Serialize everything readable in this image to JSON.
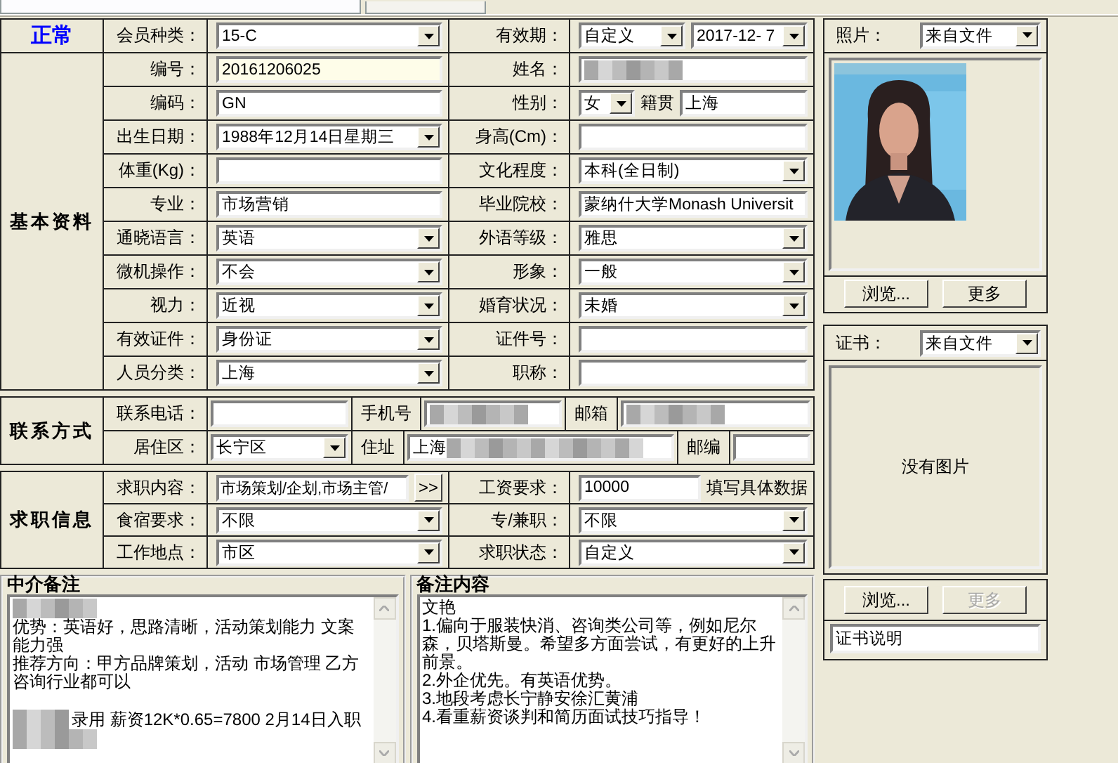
{
  "tabs": [
    {
      "selected": true
    },
    {
      "selected": false
    }
  ],
  "basic": {
    "status": "正常",
    "title": "基本资料",
    "header": {
      "left": {
        "label": "会员种类：",
        "kind": "dropdown",
        "value": "15-C"
      },
      "right": {
        "label": "有效期：",
        "kind": "dropdown-pair",
        "value": "自定义",
        "value2": "2017-12- 7"
      }
    },
    "rows": [
      {
        "left": {
          "label": "编号：",
          "kind": "highlight",
          "value": "20161206025"
        },
        "right": {
          "label": "姓名：",
          "kind": "text",
          "redacted": true
        }
      },
      {
        "left": {
          "label": "编码：",
          "kind": "text",
          "value": "GN"
        },
        "right": {
          "label": "性别：",
          "kind": "gender-origin",
          "value": "女",
          "extra_label": "籍贯",
          "extra_value": "上海"
        }
      },
      {
        "left": {
          "label": "出生日期：",
          "kind": "dropdown",
          "value": "1988年12月14日星期三"
        },
        "right": {
          "label": "身高(Cm)：",
          "kind": "text"
        }
      },
      {
        "left": {
          "label": "体重(Kg)：",
          "kind": "text"
        },
        "right": {
          "label": "文化程度：",
          "kind": "dropdown",
          "value": "本科(全日制)"
        }
      },
      {
        "left": {
          "label": "专业：",
          "kind": "text",
          "value": "市场营销"
        },
        "right": {
          "label": "毕业院校：",
          "kind": "text",
          "value": "蒙纳什大学Monash Universit"
        }
      },
      {
        "left": {
          "label": "通晓语言：",
          "kind": "dropdown",
          "value": "英语"
        },
        "right": {
          "label": "外语等级：",
          "kind": "dropdown",
          "value": "雅思"
        }
      },
      {
        "left": {
          "label": "微机操作：",
          "kind": "dropdown",
          "value": "不会"
        },
        "right": {
          "label": "形象：",
          "kind": "dropdown",
          "value": "一般"
        }
      },
      {
        "left": {
          "label": "视力：",
          "kind": "dropdown",
          "value": "近视"
        },
        "right": {
          "label": "婚育状况：",
          "kind": "dropdown",
          "value": "未婚"
        }
      },
      {
        "left": {
          "label": "有效证件：",
          "kind": "dropdown",
          "value": "身份证"
        },
        "right": {
          "label": "证件号：",
          "kind": "text"
        }
      },
      {
        "left": {
          "label": "人员分类：",
          "kind": "dropdown",
          "value": "上海"
        },
        "right": {
          "label": "职称：",
          "kind": "text"
        }
      }
    ]
  },
  "contact": {
    "title": "联系方式",
    "rows": [
      {
        "label": "联系电话：",
        "fields": [
          {
            "kind": "text"
          },
          {
            "kind": "label",
            "label": "手机号"
          },
          {
            "kind": "text",
            "redacted": true
          },
          {
            "kind": "label",
            "label": "邮箱"
          },
          {
            "kind": "text",
            "redacted": true
          }
        ]
      },
      {
        "label": "居住区：",
        "fields": [
          {
            "kind": "dropdown",
            "value": "长宁区"
          },
          {
            "kind": "label",
            "label": "住址"
          },
          {
            "kind": "text",
            "value": "上海",
            "redacted": true
          },
          {
            "kind": "label",
            "label": "邮编"
          },
          {
            "kind": "text"
          }
        ]
      }
    ]
  },
  "job": {
    "title": "求职信息",
    "rows": [
      {
        "left": {
          "label": "求职内容：",
          "kind": "more",
          "value": "市场策划/企划,市场主管/",
          "button": ">>"
        },
        "right": {
          "label": "工资要求：",
          "kind": "text-note",
          "value": "10000",
          "note": "填写具体数据"
        }
      },
      {
        "left": {
          "label": "食宿要求：",
          "kind": "dropdown",
          "value": "不限"
        },
        "right": {
          "label": "专/兼职：",
          "kind": "dropdown",
          "value": "不限"
        }
      },
      {
        "left": {
          "label": "工作地点：",
          "kind": "dropdown",
          "value": "市区"
        },
        "right": {
          "label": "求职状态：",
          "kind": "dropdown",
          "value": "自定义"
        }
      }
    ]
  },
  "notes": [
    {
      "title": "中介备注",
      "lines": [
        {
          "kind": "redacted"
        },
        {
          "kind": "text",
          "text": "优势：英语好，思路清晰，活动策划能力 文案能力强"
        },
        {
          "kind": "text",
          "text": "推荐方向：甲方品牌策划，活动 市场管理 乙方咨询行业都可以"
        },
        {
          "kind": "blank"
        },
        {
          "kind": "redacted-lead",
          "text": "录用 薪资12K*0.65=7800  2月14日入职"
        },
        {
          "kind": "redacted"
        }
      ]
    },
    {
      "title": "备注内容",
      "lines": [
        {
          "kind": "text",
          "text": "文艳"
        },
        {
          "kind": "text",
          "text": "1.偏向于服装快消、咨询类公司等，例如尼尔森，贝塔斯曼。希望多方面尝试，有更好的上升前景。"
        },
        {
          "kind": "text",
          "text": "2.外企优先。有英语优势。"
        },
        {
          "kind": "text",
          "text": "3.地段考虑长宁静安徐汇黄浦"
        },
        {
          "kind": "text",
          "text": "4.看重薪资谈判和简历面试技巧指导！"
        }
      ]
    }
  ],
  "photo": {
    "label": "照片：",
    "source": "来自文件",
    "kind": "picture",
    "buttons": [
      {
        "label": "浏览...",
        "disabled": false
      },
      {
        "label": "更多",
        "disabled": false
      }
    ]
  },
  "certificate": {
    "label": "证书：",
    "source": "来自文件",
    "empty_text": "没有图片",
    "buttons": [
      {
        "label": "浏览...",
        "disabled": false
      },
      {
        "label": "更多",
        "disabled": true
      }
    ],
    "caption": "证书说明"
  }
}
